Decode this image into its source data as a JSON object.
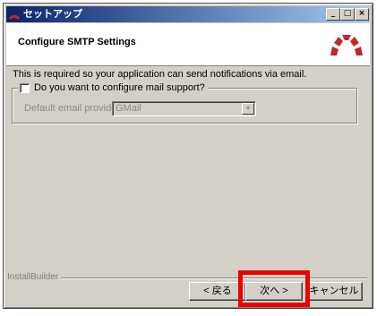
{
  "window": {
    "title": "セットアップ"
  },
  "header": {
    "title": "Configure SMTP Settings"
  },
  "main": {
    "description": "This is required so your application can send notifications via email.",
    "mail_checkbox_label": "Do you want to configure mail support?",
    "mail_checkbox_checked": false,
    "provider_label": "Default email provider:",
    "provider_value": "GMail"
  },
  "footer": {
    "brand": "InstallBuilder",
    "back_label": "< 戻る",
    "next_label": "次へ >",
    "cancel_label": "キャンセル"
  },
  "colors": {
    "logo_red": "#c0282d",
    "highlight": "#ee0000"
  }
}
